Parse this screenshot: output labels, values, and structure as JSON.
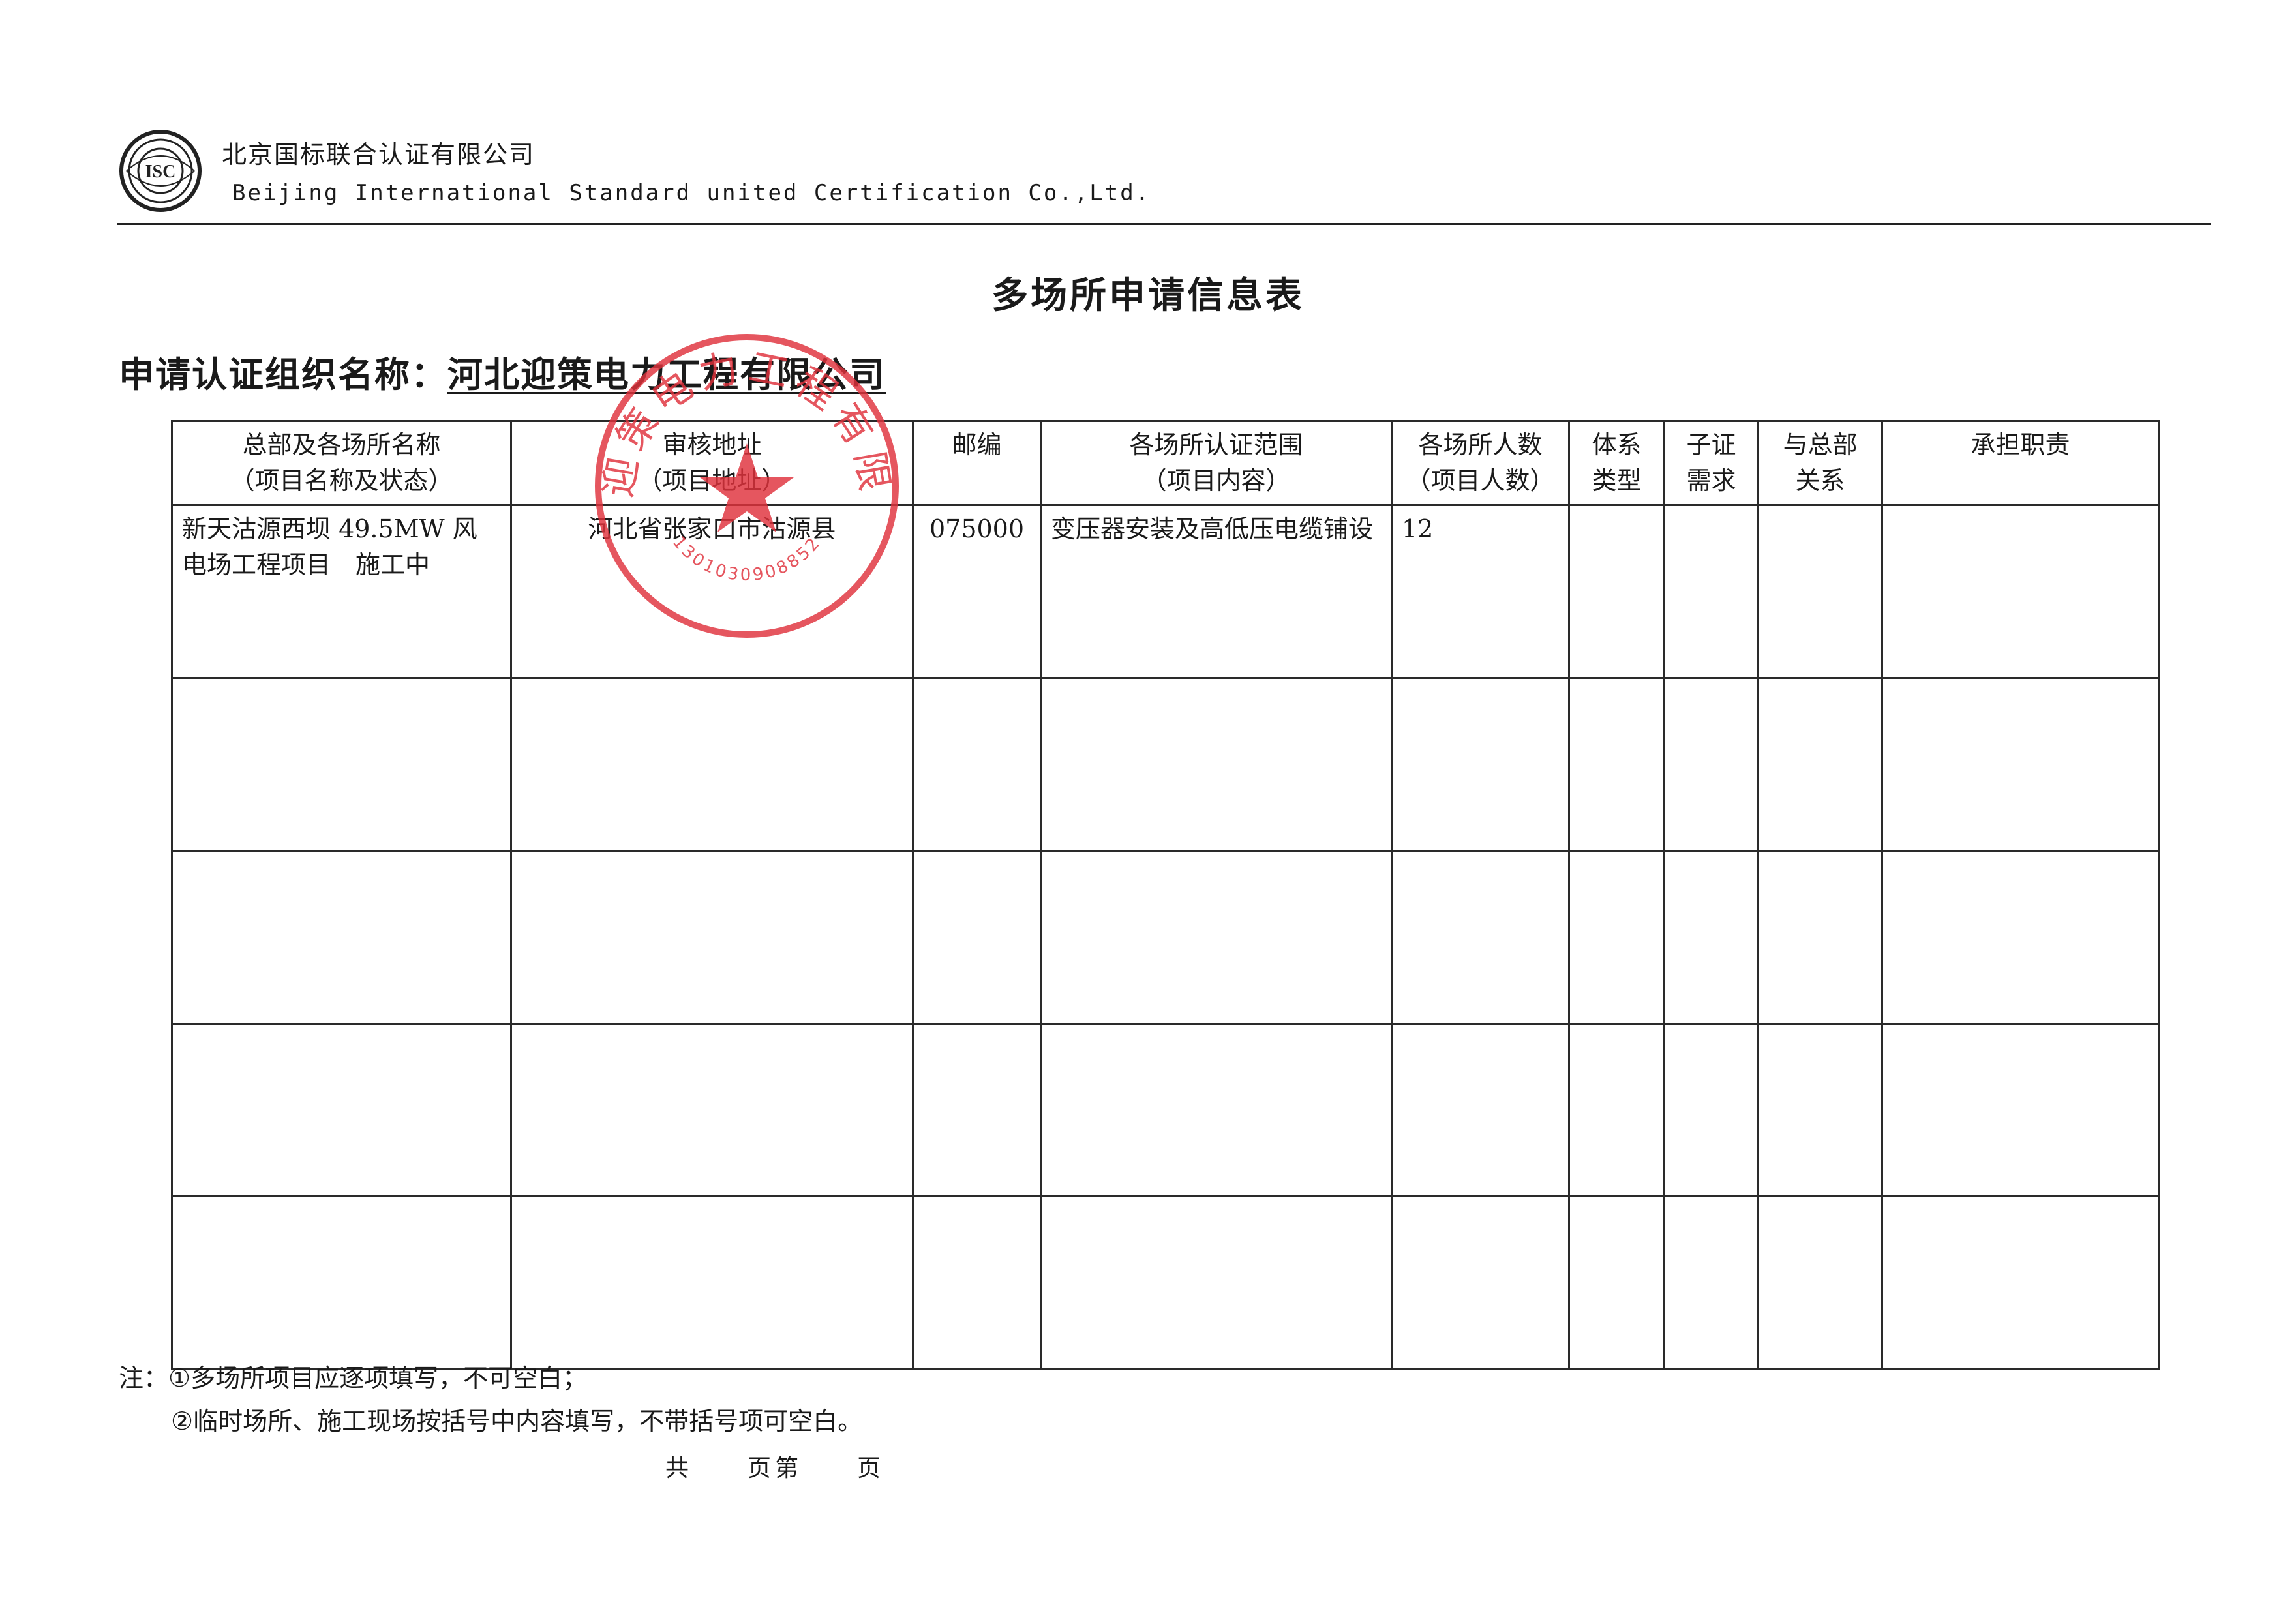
{
  "header": {
    "company_cn": "北京国标联合认证有限公司",
    "company_en": "Beijing International Standard united Certification Co.,Ltd.",
    "logo_text": "ISC"
  },
  "title": "多场所申请信息表",
  "org": {
    "label": "申请认证组织名称：",
    "name": "河北迎策电力工程有限公司"
  },
  "table": {
    "headers": [
      [
        "总部及各场所名称",
        "（项目名称及状态）"
      ],
      [
        "审核地址",
        "（项目地址）"
      ],
      [
        "邮编",
        ""
      ],
      [
        "各场所认证范围",
        "（项目内容）"
      ],
      [
        "各场所人数",
        "（项目人数）"
      ],
      [
        "体系",
        "类型"
      ],
      [
        "子证",
        "需求"
      ],
      [
        "与总部",
        "关系"
      ],
      [
        "承担职责",
        ""
      ]
    ],
    "rows": [
      [
        "新天沽源西坝 49.5MW 风电场工程项目　施工中",
        "河北省张家口市沽源县",
        "075000",
        "变压器安装及高低压电缆铺设",
        "12",
        "",
        "",
        "",
        ""
      ],
      [
        "",
        "",
        "",
        "",
        "",
        "",
        "",
        "",
        ""
      ],
      [
        "",
        "",
        "",
        "",
        "",
        "",
        "",
        "",
        ""
      ],
      [
        "",
        "",
        "",
        "",
        "",
        "",
        "",
        "",
        ""
      ],
      [
        "",
        "",
        "",
        "",
        "",
        "",
        "",
        "",
        ""
      ]
    ]
  },
  "notes": {
    "line1": "注：①多场所项目应逐项填写，不可空白；",
    "line2": "②临时场所、施工现场按括号中内容填写，不带括号项可空白。"
  },
  "page_footer": "共　　页第　　页",
  "stamp": {
    "text": "河北迎策电力工程有限公司",
    "code": "1301030908852",
    "color": "#e0323c"
  }
}
